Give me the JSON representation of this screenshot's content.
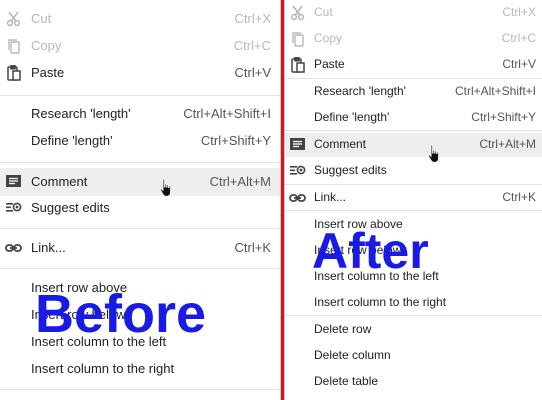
{
  "before": {
    "watermark": "Before",
    "items": {
      "cut": {
        "label": "Cut",
        "shortcut": "Ctrl+X",
        "icon": "scissors-icon"
      },
      "copy": {
        "label": "Copy",
        "shortcut": "Ctrl+C",
        "icon": "copy-icon"
      },
      "paste": {
        "label": "Paste",
        "shortcut": "Ctrl+V",
        "icon": "clipboard-icon"
      },
      "research": {
        "label": "Research 'length'",
        "shortcut": "Ctrl+Alt+Shift+I"
      },
      "define": {
        "label": "Define 'length'",
        "shortcut": "Ctrl+Shift+Y"
      },
      "comment": {
        "label": "Comment",
        "shortcut": "Ctrl+Alt+M",
        "icon": "comment-icon"
      },
      "suggest": {
        "label": "Suggest edits",
        "icon": "suggest-edits-icon"
      },
      "link": {
        "label": "Link...",
        "shortcut": "Ctrl+K",
        "icon": "link-icon"
      },
      "row_above": {
        "label": "Insert row above"
      },
      "row_below": {
        "label": "Insert row below"
      },
      "col_left": {
        "label": "Insert column to the left"
      },
      "col_right": {
        "label": "Insert column to the right"
      }
    }
  },
  "after": {
    "watermark": "After",
    "items": {
      "cut": {
        "label": "Cut",
        "shortcut": "Ctrl+X",
        "icon": "scissors-icon"
      },
      "copy": {
        "label": "Copy",
        "shortcut": "Ctrl+C",
        "icon": "copy-icon"
      },
      "paste": {
        "label": "Paste",
        "shortcut": "Ctrl+V",
        "icon": "clipboard-icon"
      },
      "research": {
        "label": "Research 'length'",
        "shortcut": "Ctrl+Alt+Shift+I"
      },
      "define": {
        "label": "Define 'length'",
        "shortcut": "Ctrl+Shift+Y"
      },
      "comment": {
        "label": "Comment",
        "shortcut": "Ctrl+Alt+M",
        "icon": "comment-icon"
      },
      "suggest": {
        "label": "Suggest edits",
        "icon": "suggest-edits-icon"
      },
      "link": {
        "label": "Link...",
        "shortcut": "Ctrl+K",
        "icon": "link-icon"
      },
      "row_above": {
        "label": "Insert row above"
      },
      "row_below": {
        "label": "Insert row below"
      },
      "col_left": {
        "label": "Insert column to the left"
      },
      "col_right": {
        "label": "Insert column to the right"
      },
      "del_row": {
        "label": "Delete row"
      },
      "del_col": {
        "label": "Delete column"
      },
      "del_table": {
        "label": "Delete table"
      }
    }
  },
  "colors": {
    "divider": "#d6171a",
    "watermark": "#1a1ae6",
    "highlight": "#eeeeee",
    "disabled_text": "#b8b8b8"
  }
}
